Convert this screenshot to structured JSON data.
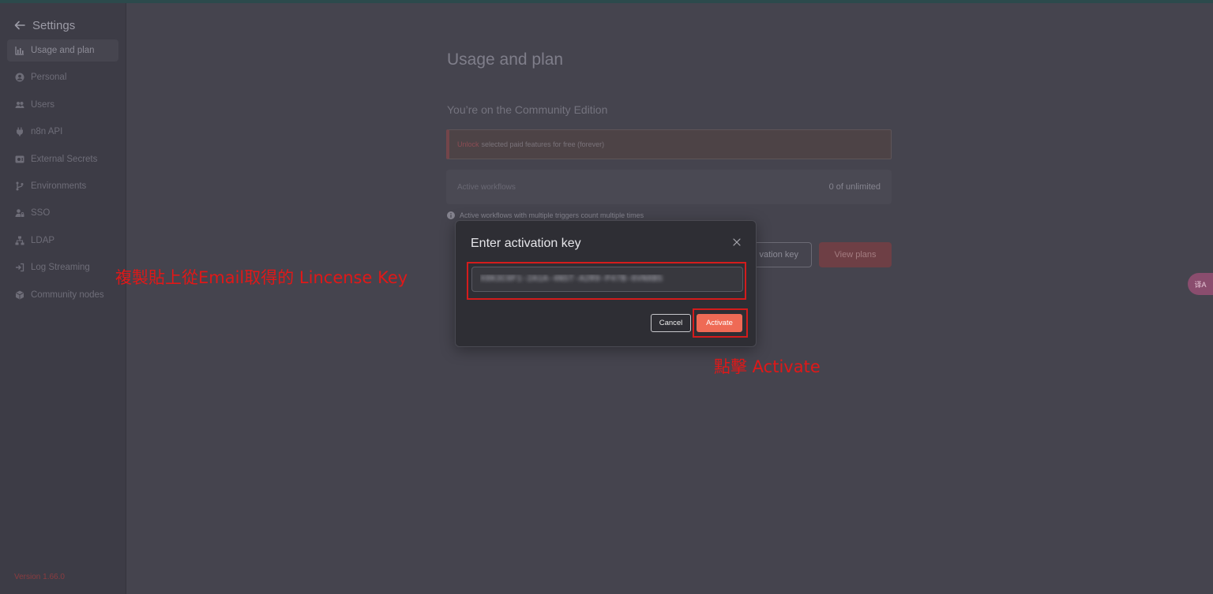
{
  "app": {
    "accent_color": "#ef6a55",
    "annotation_color": "#e01818"
  },
  "sidebar": {
    "back_icon": "arrow-left-icon",
    "title": "Settings",
    "items": [
      {
        "label": "Usage and plan",
        "icon": "bar-chart-icon",
        "active": true
      },
      {
        "label": "Personal",
        "icon": "user-circle-icon",
        "active": false
      },
      {
        "label": "Users",
        "icon": "users-icon",
        "active": false
      },
      {
        "label": "n8n API",
        "icon": "plug-icon",
        "active": false
      },
      {
        "label": "External Secrets",
        "icon": "vault-icon",
        "active": false
      },
      {
        "label": "Environments",
        "icon": "branch-icon",
        "active": false
      },
      {
        "label": "SSO",
        "icon": "user-lock-icon",
        "active": false
      },
      {
        "label": "LDAP",
        "icon": "network-icon",
        "active": false
      },
      {
        "label": "Log Streaming",
        "icon": "sign-in-icon",
        "active": false
      },
      {
        "label": "Community nodes",
        "icon": "cube-icon",
        "active": false
      }
    ],
    "version": "Version 1.66.0"
  },
  "main": {
    "title": "Usage and plan",
    "edition": "You’re on the Community Edition",
    "banner": {
      "link": "Unlock",
      "text": "selected paid features for free (forever)"
    },
    "workflows": {
      "label": "Active workflows",
      "value": "0 of unlimited"
    },
    "info_note": "Active workflows with multiple triggers count multiple times",
    "enter_key_button": "vation key",
    "view_plans_button": "View plans"
  },
  "translate_button": "译A",
  "modal": {
    "title": "Enter activation key",
    "input_value": "X8K3C9F1-2A1A-4N5T-A2R9-P47B-6VN8B5",
    "cancel_label": "Cancel",
    "activate_label": "Activate"
  },
  "annotations": {
    "paste_key": "複製貼上從Email取得的 Lincense Key",
    "click_activate": "點擊 Activate"
  }
}
